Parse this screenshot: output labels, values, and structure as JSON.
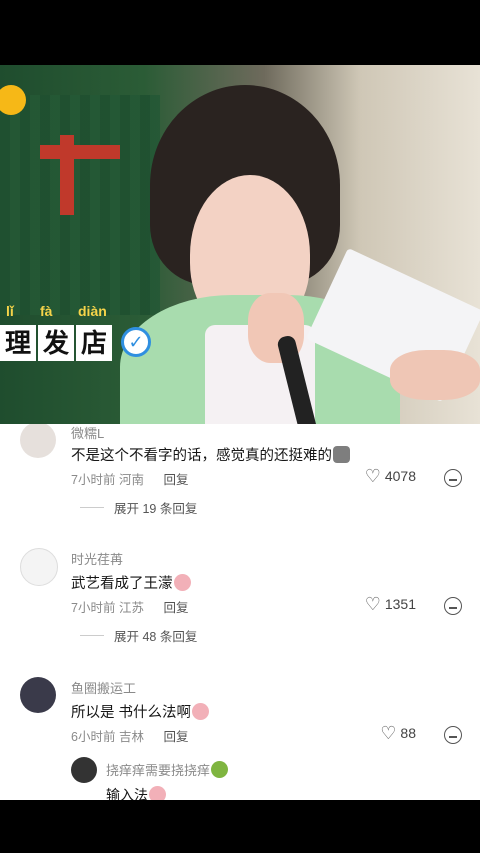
{
  "video": {
    "pinyin": [
      "lǐ",
      "fà",
      "diàn"
    ],
    "subtitle_chars": [
      "理",
      "发",
      "店"
    ]
  },
  "comments": [
    {
      "username": "微糯L",
      "text": "不是这个不看字的话，感觉真的还挺难的",
      "emoji": "crying-cat",
      "time": "7小时前",
      "location": "河南",
      "reply_label": "回复",
      "likes": "4078",
      "expand_label": "展开 19 条回复"
    },
    {
      "username": "时光荏苒",
      "text": "武艺看成了王濛",
      "emoji": "laughing-crying",
      "time": "7小时前",
      "location": "江苏",
      "reply_label": "回复",
      "likes": "1351",
      "expand_label": "展开 48 条回复"
    },
    {
      "username": "鱼圈搬运工",
      "text": "所以是 书什么法啊",
      "emoji": "laughing-crying",
      "time": "6小时前",
      "location": "吉林",
      "reply_label": "回复",
      "likes": "88",
      "sub_reply": {
        "username": "挠痒痒需要挠挠痒",
        "text": "输入法",
        "emoji": "laughing-crying"
      }
    }
  ],
  "colors": {
    "accent_blue": "#2f8fe0",
    "pinyin_yellow": "#f6d44a",
    "meta_gray": "#8a8a8a"
  }
}
